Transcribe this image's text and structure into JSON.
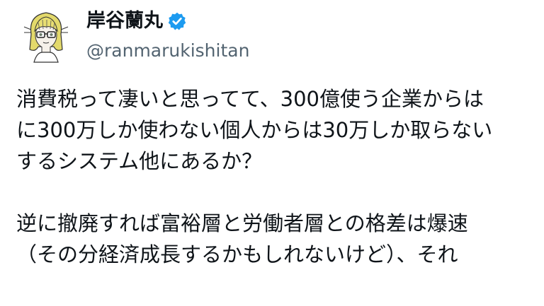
{
  "author": {
    "display_name": "岸谷蘭丸",
    "handle": "@ranmarukishitan",
    "verified_icon": "verified-badge-icon",
    "accent_color": "#1d9bf0"
  },
  "tweet": {
    "paragraph1": [
      "消費税って凄いと思ってて、300億使う企業からは",
      "に300万しか使わない個人からは30万しか取らない",
      "するシステム他にあるか？"
    ],
    "paragraph2": [
      "逆に撤廃すれば富裕層と労働者層との格差は爆速",
      "（その分経済成長するかもしれないけど）、それ"
    ]
  }
}
